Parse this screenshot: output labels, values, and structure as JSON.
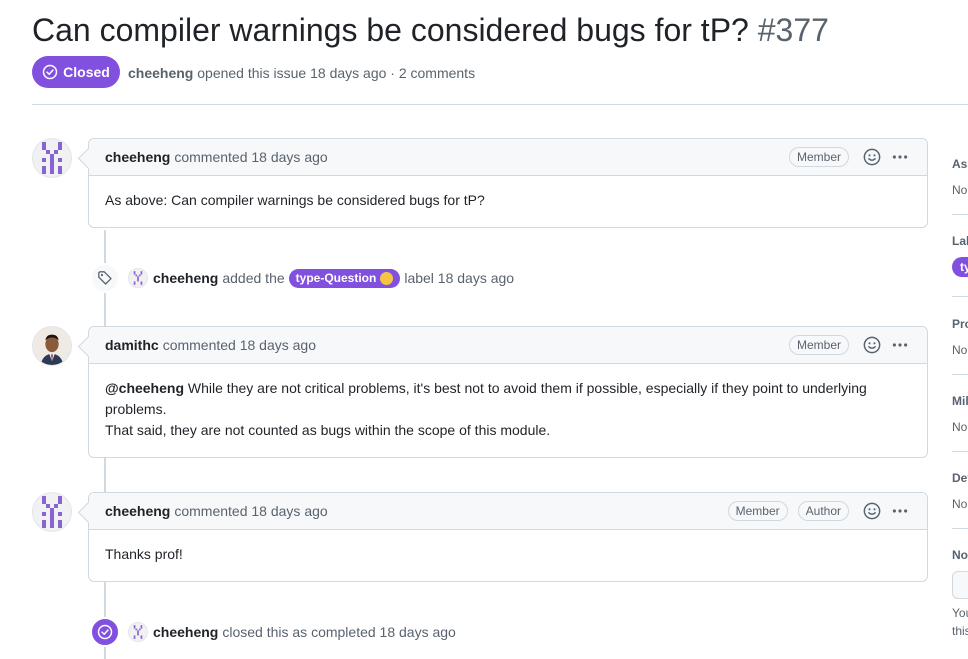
{
  "issue": {
    "title": "Can compiler warnings be considered bugs for tP?",
    "number": "#377",
    "state": "Closed",
    "author": "cheeheng",
    "opened_text": "opened this issue 18 days ago · 2 comments"
  },
  "comments": [
    {
      "author": "cheeheng",
      "time_text": "commented 18 days ago",
      "roles": [
        "Member"
      ],
      "body": [
        "As above: Can compiler warnings be considered bugs for tP?"
      ]
    },
    {
      "author": "damithc",
      "time_text": "commented 18 days ago",
      "roles": [
        "Member"
      ],
      "mention": "@cheeheng",
      "body": [
        "While they are not critical problems, it's best not to avoid them if possible, especially if they point to underlying problems.",
        "That said, they are not counted as bugs within the scope of this module."
      ]
    },
    {
      "author": "cheeheng",
      "time_text": "commented 18 days ago",
      "roles": [
        "Member",
        "Author"
      ],
      "body": [
        "Thanks prof!"
      ]
    }
  ],
  "events": {
    "label_added": {
      "author": "cheeheng",
      "action": "added the",
      "label": "type-Question",
      "suffix": "label 18 days ago"
    },
    "closed": {
      "author": "cheeheng",
      "action": "closed this as completed 18 days ago"
    }
  },
  "sidebar": {
    "assignees_title": "Ass",
    "assignees_value": "No",
    "labels_title": "Lab",
    "labels_value": "ty",
    "projects_title": "Pro",
    "projects_value": "No",
    "milestone_title": "Mil",
    "milestone_value": "No",
    "development_title": "Dev",
    "development_value": "No",
    "notifications_title": "No",
    "notifications_text_1": "You",
    "notifications_text_2": "this"
  },
  "colors": {
    "closed_purple": "#8250df",
    "border": "#d1d9e0",
    "header_bg": "#f6f8fa"
  },
  "icons": {
    "state": "check-circle-icon",
    "label_event": "tag-icon",
    "closed_event": "check-circle-icon",
    "reaction": "smiley-icon",
    "menu": "kebab-horizontal-icon"
  }
}
